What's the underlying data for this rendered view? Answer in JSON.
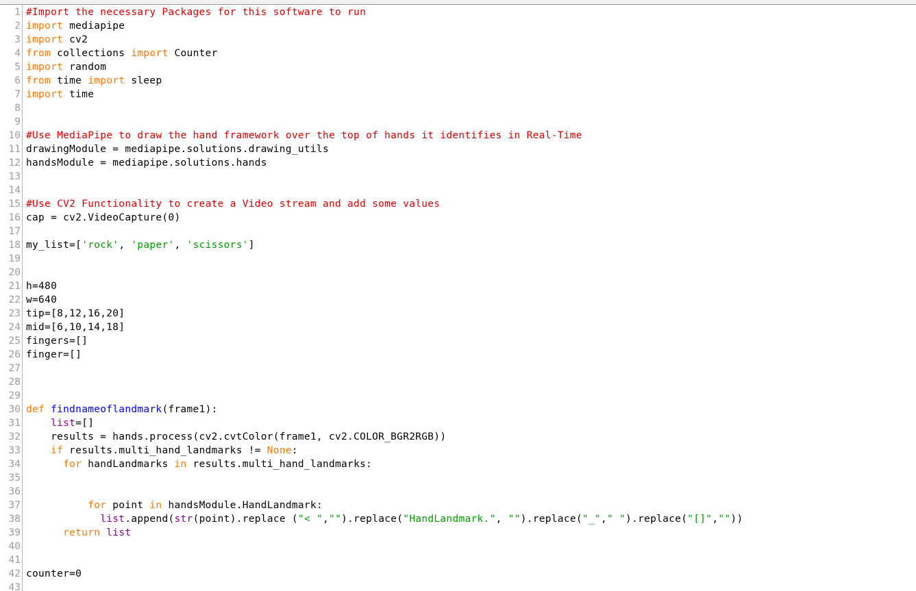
{
  "window": {
    "title": "Python code editor",
    "background_color": "#ffffff",
    "top_strip_color": "#f2f2f2",
    "gutter_color": "#9b9b9b",
    "separator_color": "#b5b5b5"
  },
  "theme": {
    "comment_color": "#dd0000",
    "keyword_color": "#ff7700",
    "string_color": "#00a000",
    "function_color": "#0000ff",
    "builtin_color": "#900090",
    "plain_color": "#000000"
  },
  "editor": {
    "first_visible_line": 1,
    "last_visible_line": 43,
    "language": "Python",
    "lines": [
      {
        "n": "1",
        "tokens": [
          {
            "t": "#Import the necessary Packages for this software to run",
            "c": "cm"
          }
        ]
      },
      {
        "n": "2",
        "tokens": [
          {
            "t": "import",
            "c": "kw"
          },
          {
            "t": " mediapipe",
            "c": "pl"
          }
        ]
      },
      {
        "n": "3",
        "tokens": [
          {
            "t": "import",
            "c": "kw"
          },
          {
            "t": " cv2",
            "c": "pl"
          }
        ]
      },
      {
        "n": "4",
        "tokens": [
          {
            "t": "from",
            "c": "kw"
          },
          {
            "t": " collections ",
            "c": "pl"
          },
          {
            "t": "import",
            "c": "kw"
          },
          {
            "t": " Counter",
            "c": "pl"
          }
        ]
      },
      {
        "n": "5",
        "tokens": [
          {
            "t": "import",
            "c": "kw"
          },
          {
            "t": " random",
            "c": "pl"
          }
        ]
      },
      {
        "n": "6",
        "tokens": [
          {
            "t": "from",
            "c": "kw"
          },
          {
            "t": " time ",
            "c": "pl"
          },
          {
            "t": "import",
            "c": "kw"
          },
          {
            "t": " sleep",
            "c": "pl"
          }
        ]
      },
      {
        "n": "7",
        "tokens": [
          {
            "t": "import",
            "c": "kw"
          },
          {
            "t": " time",
            "c": "pl"
          }
        ]
      },
      {
        "n": "8",
        "tokens": []
      },
      {
        "n": "9",
        "tokens": []
      },
      {
        "n": "10",
        "tokens": [
          {
            "t": "#Use MediaPipe to draw the hand framework over the top of hands it identifies in Real-Time",
            "c": "cm"
          }
        ]
      },
      {
        "n": "11",
        "tokens": [
          {
            "t": "drawingModule = mediapipe.solutions.drawing_utils",
            "c": "pl"
          }
        ]
      },
      {
        "n": "12",
        "tokens": [
          {
            "t": "handsModule = mediapipe.solutions.hands",
            "c": "pl"
          }
        ]
      },
      {
        "n": "13",
        "tokens": []
      },
      {
        "n": "14",
        "tokens": []
      },
      {
        "n": "15",
        "tokens": [
          {
            "t": "#Use CV2 Functionality to create a Video stream and add some values",
            "c": "cm"
          }
        ]
      },
      {
        "n": "16",
        "tokens": [
          {
            "t": "cap = cv2.VideoCapture(0)",
            "c": "pl"
          }
        ]
      },
      {
        "n": "17",
        "tokens": []
      },
      {
        "n": "18",
        "tokens": [
          {
            "t": "my_list=[",
            "c": "pl"
          },
          {
            "t": "'rock'",
            "c": "str"
          },
          {
            "t": ", ",
            "c": "pl"
          },
          {
            "t": "'paper'",
            "c": "str"
          },
          {
            "t": ", ",
            "c": "pl"
          },
          {
            "t": "'scissors'",
            "c": "str"
          },
          {
            "t": "]",
            "c": "pl"
          }
        ]
      },
      {
        "n": "19",
        "tokens": []
      },
      {
        "n": "20",
        "tokens": []
      },
      {
        "n": "21",
        "tokens": [
          {
            "t": "h=480",
            "c": "pl"
          }
        ]
      },
      {
        "n": "22",
        "tokens": [
          {
            "t": "w=640",
            "c": "pl"
          }
        ]
      },
      {
        "n": "23",
        "tokens": [
          {
            "t": "tip=[8,12,16,20]",
            "c": "pl"
          }
        ]
      },
      {
        "n": "24",
        "tokens": [
          {
            "t": "mid=[6,10,14,18]",
            "c": "pl"
          }
        ]
      },
      {
        "n": "25",
        "tokens": [
          {
            "t": "fingers=[]",
            "c": "pl"
          }
        ]
      },
      {
        "n": "26",
        "tokens": [
          {
            "t": "finger=[]",
            "c": "pl"
          }
        ]
      },
      {
        "n": "27",
        "tokens": []
      },
      {
        "n": "28",
        "tokens": []
      },
      {
        "n": "29",
        "tokens": []
      },
      {
        "n": "30",
        "tokens": [
          {
            "t": "def",
            "c": "kw"
          },
          {
            "t": " ",
            "c": "pl"
          },
          {
            "t": "findnameoflandmark",
            "c": "fn"
          },
          {
            "t": "(frame1):",
            "c": "pl"
          }
        ]
      },
      {
        "n": "31",
        "tokens": [
          {
            "t": "    ",
            "c": "pl"
          },
          {
            "t": "list",
            "c": "bi"
          },
          {
            "t": "=[]",
            "c": "pl"
          }
        ]
      },
      {
        "n": "32",
        "tokens": [
          {
            "t": "    results = hands.process(cv2.cvtColor(frame1, cv2.COLOR_BGR2RGB))",
            "c": "pl"
          }
        ]
      },
      {
        "n": "33",
        "tokens": [
          {
            "t": "    ",
            "c": "pl"
          },
          {
            "t": "if",
            "c": "kw"
          },
          {
            "t": " results.multi_hand_landmarks != ",
            "c": "pl"
          },
          {
            "t": "None",
            "c": "kw"
          },
          {
            "t": ":",
            "c": "pl"
          }
        ]
      },
      {
        "n": "34",
        "tokens": [
          {
            "t": "      ",
            "c": "pl"
          },
          {
            "t": "for",
            "c": "kw"
          },
          {
            "t": " handLandmarks ",
            "c": "pl"
          },
          {
            "t": "in",
            "c": "kw"
          },
          {
            "t": " results.multi_hand_landmarks:",
            "c": "pl"
          }
        ]
      },
      {
        "n": "35",
        "tokens": []
      },
      {
        "n": "36",
        "tokens": []
      },
      {
        "n": "37",
        "tokens": [
          {
            "t": "          ",
            "c": "pl"
          },
          {
            "t": "for",
            "c": "kw"
          },
          {
            "t": " point ",
            "c": "pl"
          },
          {
            "t": "in",
            "c": "kw"
          },
          {
            "t": " handsModule.HandLandmark:",
            "c": "pl"
          }
        ]
      },
      {
        "n": "38",
        "tokens": [
          {
            "t": "            ",
            "c": "pl"
          },
          {
            "t": "list",
            "c": "bi"
          },
          {
            "t": ".append(",
            "c": "pl"
          },
          {
            "t": "str",
            "c": "bi"
          },
          {
            "t": "(point).replace (",
            "c": "pl"
          },
          {
            "t": "\"< \"",
            "c": "str"
          },
          {
            "t": ",",
            "c": "pl"
          },
          {
            "t": "\"\"",
            "c": "str"
          },
          {
            "t": ").replace(",
            "c": "pl"
          },
          {
            "t": "\"HandLandmark.\"",
            "c": "str"
          },
          {
            "t": ", ",
            "c": "pl"
          },
          {
            "t": "\"\"",
            "c": "str"
          },
          {
            "t": ").replace(",
            "c": "pl"
          },
          {
            "t": "\"_\"",
            "c": "str"
          },
          {
            "t": ",",
            "c": "pl"
          },
          {
            "t": "\" \"",
            "c": "str"
          },
          {
            "t": ").replace(",
            "c": "pl"
          },
          {
            "t": "\"[]\"",
            "c": "str"
          },
          {
            "t": ",",
            "c": "pl"
          },
          {
            "t": "\"\"",
            "c": "str"
          },
          {
            "t": "))",
            "c": "pl"
          }
        ]
      },
      {
        "n": "39",
        "tokens": [
          {
            "t": "      ",
            "c": "pl"
          },
          {
            "t": "return",
            "c": "kw"
          },
          {
            "t": " ",
            "c": "pl"
          },
          {
            "t": "list",
            "c": "bi"
          }
        ]
      },
      {
        "n": "40",
        "tokens": []
      },
      {
        "n": "41",
        "tokens": []
      },
      {
        "n": "42",
        "tokens": [
          {
            "t": "counter=0",
            "c": "pl"
          }
        ]
      },
      {
        "n": "43",
        "tokens": []
      }
    ]
  }
}
